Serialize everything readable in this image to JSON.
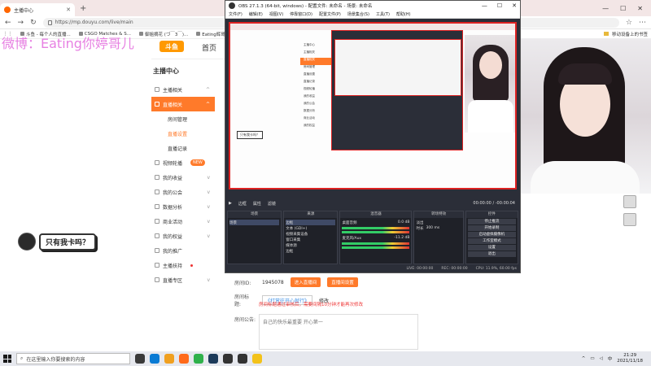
{
  "browser": {
    "tab_title": "主播中心",
    "new_tab": "+",
    "url": "https://mp.douyu.com/live/main",
    "bookmarks": [
      "斗鱼 - 每个人的直播...",
      "CSGO Matches & S...",
      "御姐摘花 (づ￣3￣)...",
      "Eating辉哥儿直播_CS..."
    ],
    "bookmark_right": "移动设备上的书签",
    "window_controls": [
      "—",
      "☐",
      "✕"
    ]
  },
  "watermark": "微博：Eating你婷哥儿",
  "site": {
    "logo": "斗鱼",
    "home": "首页"
  },
  "sidebar": {
    "title": "主播中心",
    "items": [
      {
        "label": "主播相关",
        "arrow": "^"
      },
      {
        "label": "直播相关",
        "arrow": "^",
        "active": true
      },
      {
        "label": "视频轮播",
        "badge": "NEW"
      },
      {
        "label": "我的收益",
        "arrow": "v"
      },
      {
        "label": "我的公会",
        "arrow": "v"
      },
      {
        "label": "数据分析",
        "arrow": "v"
      },
      {
        "label": "商业活动",
        "arrow": "v"
      },
      {
        "label": "我的权益",
        "arrow": "v"
      },
      {
        "label": "我的推广"
      },
      {
        "label": "主播扶持",
        "dot": true
      },
      {
        "label": "直播专区",
        "arrow": "v"
      }
    ],
    "subitems": [
      "房间管理",
      "直播设置",
      "直播记录"
    ]
  },
  "chat": {
    "message": "只有我卡吗？"
  },
  "room": {
    "id_label": "房间ID:",
    "id_value": "1945078",
    "enter_btn": "进入直播间",
    "settings_btn": "直播间设置",
    "title_label": "房间标题:",
    "title_value": "《打赏往开心就行》",
    "edit": "修改",
    "warning": "房间标题通过审核后，需要间隔10分钟才能再次修改",
    "notice_label": "房间公告:",
    "notice_value": "自己的快乐最重要 开心第一"
  },
  "obs": {
    "title": "OBS 27.1.3 (64-bit, windows) - 配置文件: 未命名 - 场景: 未命名",
    "menu": [
      "文件(F)",
      "编辑(E)",
      "视图(V)",
      "停靠窗口(D)",
      "配置文件(P)",
      "场景集合(S)",
      "工具(T)",
      "帮助(H)"
    ],
    "preview_chat": "只有我卡吗？",
    "ctrlbar": {
      "stop": "▶",
      "source_label": "边框",
      "prop": "属性",
      "filter": "滤镜",
      "time": "00:00:00 / -00:00:04"
    },
    "panels": {
      "scenes": "场景",
      "sources": "来源",
      "mixer": "混音器",
      "transitions": "转场特效",
      "controls": "控件"
    },
    "scene_items": [
      "场景"
    ],
    "source_items": [
      "边框",
      "文本 (GDI+)",
      "视频采集设备",
      "窗口采集",
      "媒体源",
      "边框"
    ],
    "mixer_items": [
      {
        "name": "桌面音频",
        "db": "0.0 dB"
      },
      {
        "name": "麦克风/Aux",
        "db": "-11.2 dB"
      }
    ],
    "transition": {
      "type": "淡出",
      "duration_label": "时长",
      "duration": "300 ms"
    },
    "control_buttons": [
      "停止推流",
      "开始录制",
      "启动虚拟摄像机",
      "工作室模式",
      "设置",
      "退出"
    ],
    "status": [
      "LIVE: 00:00:00",
      "REC: 00:00:00",
      "CPU: 11.9%, 60.00 fps"
    ]
  },
  "taskbar": {
    "search": "在这里输入你要搜索的内容",
    "time": "21:29",
    "date": "2021/11/18"
  }
}
